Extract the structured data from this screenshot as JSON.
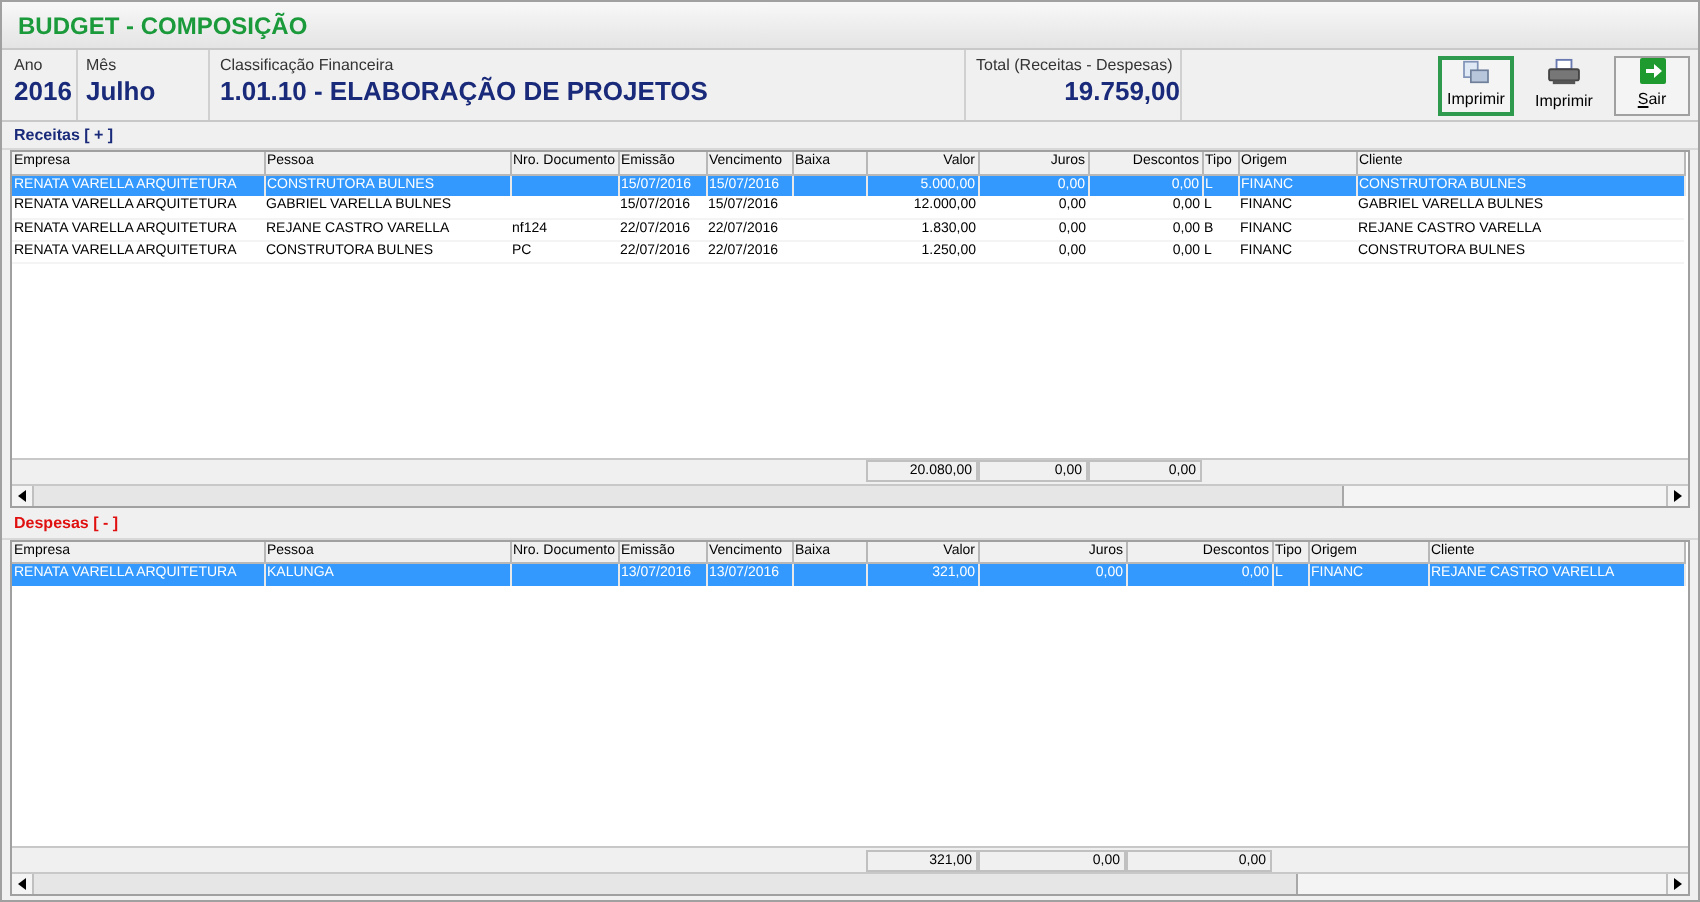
{
  "window": {
    "title": "BUDGET - COMPOSIÇÃO"
  },
  "header": {
    "ano_label": "Ano",
    "ano": "2016",
    "mes_label": "Mês",
    "mes": "Julho",
    "classificacao_label": "Classificação Financeira",
    "classificacao": "1.01.10 - ELABORAÇÃO DE PROJETOS",
    "total_label": "Total (Receitas - Despesas)",
    "total": "19.759,00"
  },
  "toolbar": [
    {
      "label": "Imprimir",
      "kind": "preview",
      "focused": true
    },
    {
      "label": "Imprimir",
      "kind": "printer",
      "focused": false
    },
    {
      "label": "Sair",
      "kind": "exit",
      "focused": false
    }
  ],
  "receitas": {
    "title": "Receitas [ + ]",
    "columns": [
      "Empresa",
      "Pessoa",
      "Nro. Documento",
      "Emissão",
      "Vencimento",
      "Baixa",
      "Valor",
      "Juros",
      "Descontos",
      "Tipo",
      "Origem",
      "Cliente"
    ],
    "rows": [
      {
        "selected": true,
        "cells": [
          "RENATA VARELLA ARQUITETURA",
          "CONSTRUTORA BULNES",
          "",
          "15/07/2016",
          "15/07/2016",
          "",
          "5.000,00",
          "0,00",
          "0,00",
          "L",
          "FINANC",
          "CONSTRUTORA BULNES"
        ]
      },
      {
        "selected": false,
        "cells": [
          "RENATA VARELLA ARQUITETURA",
          "GABRIEL VARELLA BULNES",
          "",
          "15/07/2016",
          "15/07/2016",
          "",
          "12.000,00",
          "0,00",
          "0,00",
          "L",
          "FINANC",
          "GABRIEL VARELLA BULNES"
        ]
      },
      {
        "selected": false,
        "cells": [
          "RENATA VARELLA ARQUITETURA",
          "REJANE CASTRO VARELLA",
          "nf124",
          "22/07/2016",
          "22/07/2016",
          "",
          "1.830,00",
          "0,00",
          "0,00",
          "B",
          "FINANC",
          "REJANE CASTRO VARELLA"
        ]
      },
      {
        "selected": false,
        "cells": [
          "RENATA VARELLA ARQUITETURA",
          "CONSTRUTORA BULNES",
          "PC",
          "22/07/2016",
          "22/07/2016",
          "",
          "1.250,00",
          "0,00",
          "0,00",
          "L",
          "FINANC",
          "CONSTRUTORA BULNES"
        ]
      }
    ],
    "totals": [
      "20.080,00",
      "0,00",
      "0,00"
    ]
  },
  "despesas": {
    "title": "Despesas [ - ]",
    "columns": [
      "Empresa",
      "Pessoa",
      "Nro. Documento",
      "Emissão",
      "Vencimento",
      "Baixa",
      "Valor",
      "Juros",
      "Descontos",
      "Tipo",
      "Origem",
      "Cliente"
    ],
    "rows": [
      {
        "selected": true,
        "cells": [
          "RENATA VARELLA ARQUITETURA",
          "KALUNGA",
          "",
          "13/07/2016",
          "13/07/2016",
          "",
          "321,00",
          "0,00",
          "0,00",
          "L",
          "FINANC",
          "REJANE CASTRO VARELLA"
        ]
      }
    ],
    "totals": [
      "321,00",
      "0,00",
      "0,00"
    ]
  }
}
